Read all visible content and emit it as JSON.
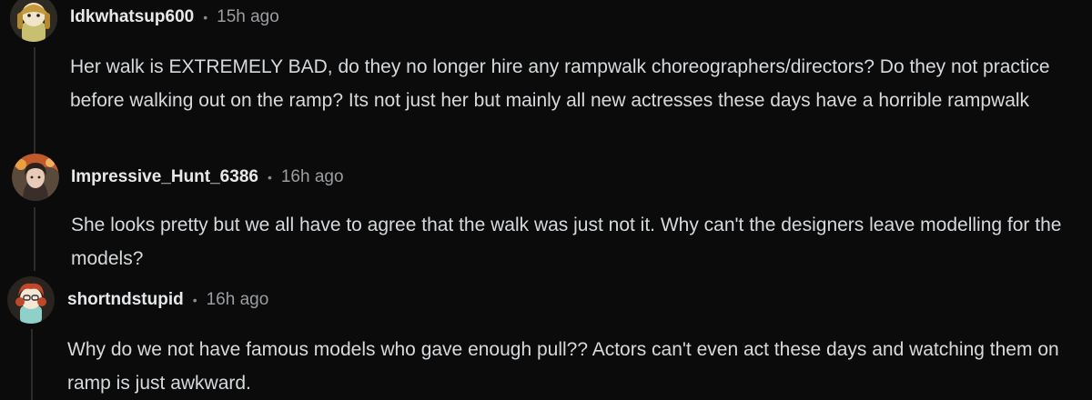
{
  "comments": [
    {
      "username": "Idkwhatsup600",
      "separator": "•",
      "time": "15h ago",
      "text": "Her walk is EXTREMELY BAD, do they no longer hire any rampwalk choreographers/directors? Do they not practice before walking out on the ramp? Its not just her but mainly all new actresses these days have a horrible rampwalk",
      "avatar": "snoo-avatar-yellow-hat-icon"
    },
    {
      "username": "Impressive_Hunt_6386",
      "separator": "•",
      "time": "16h ago",
      "text": "She looks pretty but we all have to agree that the walk was just not it. Why can't the designers leave modelling for the models?",
      "avatar": "photo-avatar-woman-icon"
    },
    {
      "username": "shortndstupid",
      "separator": "•",
      "time": "16h ago",
      "text": "Why do we not have famous models who gave enough pull?? Actors can't even act these days and watching them on ramp is just awkward.",
      "avatar": "snoo-avatar-red-hair-icon"
    }
  ],
  "colors": {
    "background": "#0b0b0c",
    "text": "#d7dadc",
    "meta": "#9b9ea1",
    "thread_line": "#2a2c2e"
  }
}
